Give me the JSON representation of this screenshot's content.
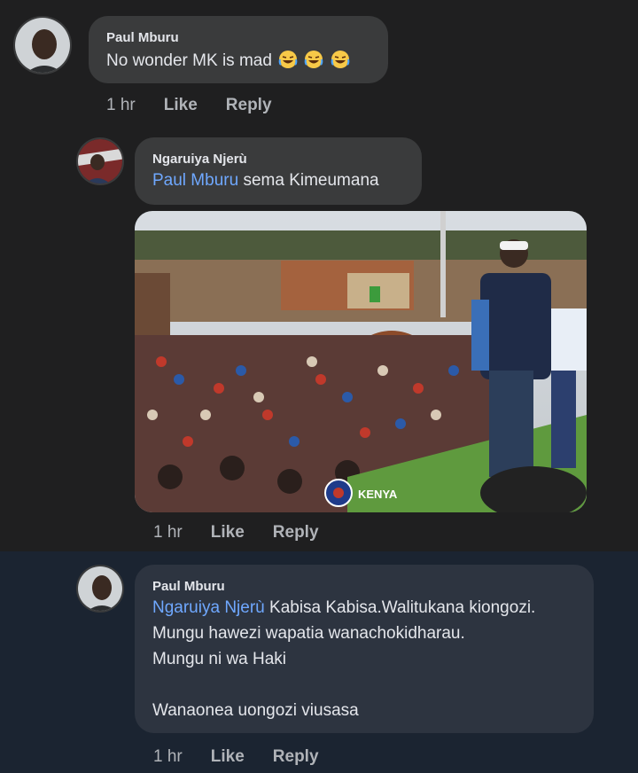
{
  "comments": [
    {
      "author": "Paul Mburu",
      "text": "No wonder MK is mad",
      "emoji": "crying-laughing-emoji x3",
      "time": "1 hr",
      "like": "Like",
      "reply": "Reply"
    },
    {
      "author": "Ngaruiya Njerù",
      "mention": "Paul Mburu",
      "text": "sema Kimeumana",
      "photo_overlay": "KENYA",
      "time": "1 hr",
      "like": "Like",
      "reply": "Reply"
    },
    {
      "author": "Paul Mburu",
      "mention": "Ngaruiya Njerù",
      "line1": "Kabisa Kabisa.Walitukana kiongozi.",
      "line2": "Mungu hawezi wapatia wanachokidharau.",
      "line3": "Mungu ni wa Haki",
      "line4": "Wanaonea uongozi viusasa",
      "time": "1 hr",
      "like": "Like",
      "reply": "Reply"
    }
  ],
  "colors": {
    "background": "#1f1f20",
    "highlight_background": "#1b2431",
    "bubble": "#3a3b3c",
    "mention": "#6fa8ff",
    "meta": "#b0b3b8"
  }
}
